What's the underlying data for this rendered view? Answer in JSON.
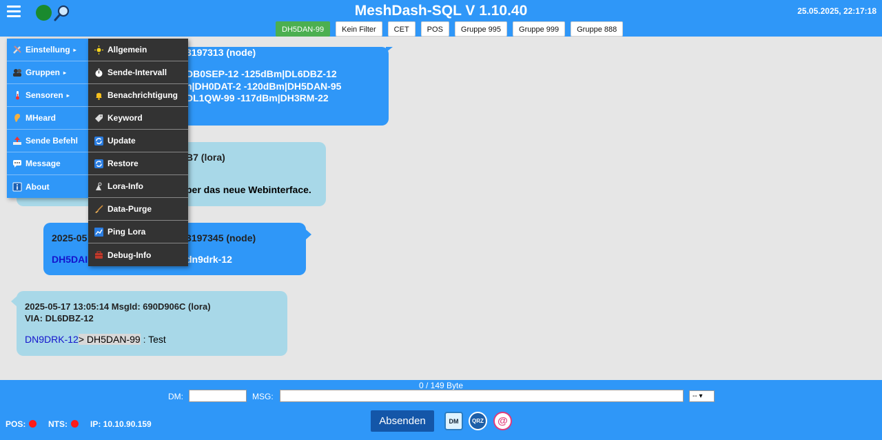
{
  "header": {
    "title": "MeshDash-SQL V 1.10.40",
    "datetime": "25.05.2025, 22:17:18",
    "filters": [
      {
        "label": "DH5DAN-99",
        "active": true
      },
      {
        "label": "Kein Filter",
        "active": false
      },
      {
        "label": "CET",
        "active": false
      },
      {
        "label": "POS",
        "active": false
      },
      {
        "label": "Gruppe 995",
        "active": false
      },
      {
        "label": "Gruppe 999",
        "active": false
      },
      {
        "label": "Gruppe 888",
        "active": false
      }
    ]
  },
  "messages": [
    {
      "type": "node",
      "header_fragment": "3197313 (node)",
      "lines": [
        "DB0SEP-12 -125dBm|DL6DBZ-12",
        "n|DH0DAT-2 -120dBm|DH5DAN-95",
        "DL1QW-99 -117dBm|DH3RM-22"
      ]
    },
    {
      "type": "lora",
      "header_fragment": "B7 (lora)",
      "text_fragment": "ber das neue Webinterface."
    },
    {
      "type": "node",
      "header_prefix": "2025-05",
      "header_fragment": "3197345 (node)",
      "from_fragment": "DH5DAI",
      "text_fragment": "dn9drk-12"
    },
    {
      "type": "lora",
      "header": "2025-05-17 13:05:14 MsgId: 690D906C (lora)",
      "via": "VIA: DL6DBZ-12",
      "from": "DN9DRK-12",
      "to": "> DH5DAN-99",
      "separator": " : ",
      "text": "Test"
    }
  ],
  "main_menu": [
    {
      "label": "Einstellung",
      "icon": "tools-icon",
      "has_submenu": true
    },
    {
      "label": "Gruppen",
      "icon": "group-icon",
      "has_submenu": true
    },
    {
      "label": "Sensoren",
      "icon": "thermometer-icon",
      "has_submenu": true
    },
    {
      "label": "MHeard",
      "icon": "ear-icon",
      "has_submenu": false
    },
    {
      "label": "Sende Befehl",
      "icon": "send-icon",
      "has_submenu": false
    },
    {
      "label": "Message",
      "icon": "chat-icon",
      "has_submenu": false
    },
    {
      "label": "About",
      "icon": "info-icon",
      "has_submenu": false
    }
  ],
  "sub_menu": [
    {
      "label": "Allgemein",
      "icon": "sun-icon"
    },
    {
      "label": "Sende-Intervall",
      "icon": "stopwatch-icon"
    },
    {
      "label": "Benachrichtigung",
      "icon": "bell-icon"
    },
    {
      "label": "Keyword",
      "icon": "tag-icon"
    },
    {
      "label": "Update",
      "icon": "refresh-icon"
    },
    {
      "label": "Restore",
      "icon": "restore-icon"
    },
    {
      "label": "Lora-Info",
      "icon": "antenna-icon"
    },
    {
      "label": "Data-Purge",
      "icon": "broom-icon"
    },
    {
      "label": "Ping Lora",
      "icon": "chart-icon"
    },
    {
      "label": "Debug-Info",
      "icon": "toolbox-icon"
    }
  ],
  "footer": {
    "byte_count": "0 / 149 Byte",
    "dm_label": "DM:",
    "dm_value": "",
    "msg_label": "MSG:",
    "msg_value": "",
    "select_value": "-- ▾",
    "send_label": "Absenden",
    "dm_button": "DM",
    "qrz_button": "QRZ",
    "mail_button": "@",
    "pos_label": "POS:",
    "nts_label": "NTS:",
    "ip_label": "IP: 10.10.90.159"
  },
  "colors": {
    "accent": "#2f97f8",
    "active_filter": "#4caf50",
    "lora_bubble": "#a8d8e8",
    "status_red": "#ff1a1a",
    "status_green": "#1a8a2e"
  }
}
